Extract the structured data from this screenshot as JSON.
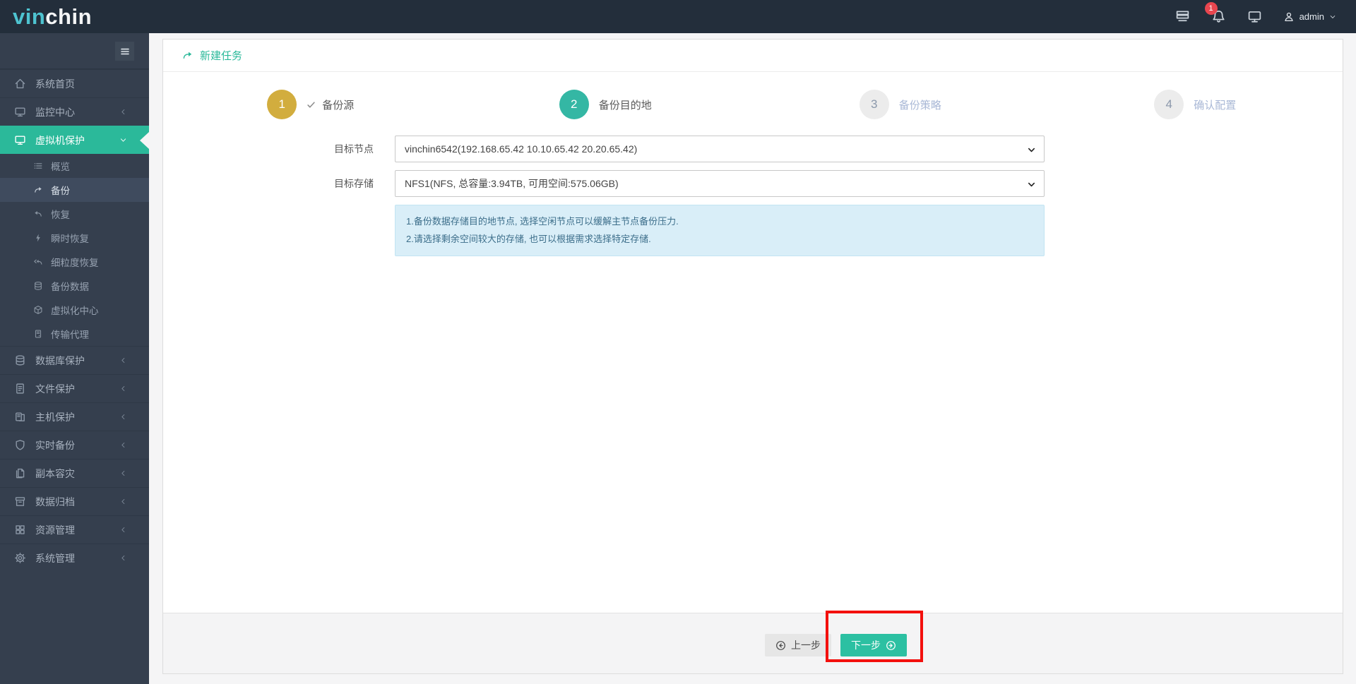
{
  "colors": {
    "accent_teal": "#2bb99a",
    "button_teal": "#2cc0a2",
    "step_done_gold": "#d2ad3e",
    "step_active_teal": "#34b7a4",
    "notification_red": "#e8464f",
    "annotation_red": "#f3100d",
    "info_box_bg": "#d9eef8",
    "header_bg": "#232e3b",
    "sidebar_bg": "#353f4e"
  },
  "header": {
    "logo_part1": "vin",
    "logo_part2": "chin",
    "notification_count": "1",
    "username": "admin"
  },
  "sidebar": {
    "items": [
      {
        "label": "系统首页",
        "icon": "home-icon"
      },
      {
        "label": "监控中心",
        "icon": "monitor-icon"
      },
      {
        "label": "虚拟机保护",
        "icon": "vm-monitor-icon"
      },
      {
        "label": "数据库保护",
        "icon": "database-icon"
      },
      {
        "label": "文件保护",
        "icon": "file-icon"
      },
      {
        "label": "主机保护",
        "icon": "host-icon"
      },
      {
        "label": "实时备份",
        "icon": "shield-icon"
      },
      {
        "label": "副本容灾",
        "icon": "copy-icon"
      },
      {
        "label": "数据归档",
        "icon": "archive-icon"
      },
      {
        "label": "资源管理",
        "icon": "grid-icon"
      },
      {
        "label": "系统管理",
        "icon": "gear-icon"
      }
    ],
    "vm_submenu": [
      {
        "label": "概览",
        "icon": "list-icon"
      },
      {
        "label": "备份",
        "icon": "redo-arrow-icon"
      },
      {
        "label": "恢复",
        "icon": "undo-arrow-icon"
      },
      {
        "label": "瞬时恢复",
        "icon": "bolt-icon"
      },
      {
        "label": "细粒度恢复",
        "icon": "undo-double-icon"
      },
      {
        "label": "备份数据",
        "icon": "database-icon"
      },
      {
        "label": "虚拟化中心",
        "icon": "cube-icon"
      },
      {
        "label": "传输代理",
        "icon": "server-icon"
      }
    ]
  },
  "page": {
    "title": "新建任务"
  },
  "wizard": {
    "steps": [
      {
        "num": "1",
        "label": "备份源",
        "state": "done"
      },
      {
        "num": "2",
        "label": "备份目的地",
        "state": "active"
      },
      {
        "num": "3",
        "label": "备份策略",
        "state": "pending"
      },
      {
        "num": "4",
        "label": "确认配置",
        "state": "pending"
      }
    ]
  },
  "form": {
    "rows": [
      {
        "label": "目标节点",
        "value": "vinchin6542(192.168.65.42 10.10.65.42 20.20.65.42)"
      },
      {
        "label": "目标存储",
        "value": "NFS1(NFS, 总容量:3.94TB, 可用空间:575.06GB)"
      }
    ],
    "info_lines": [
      "1.备份数据存储目的地节点, 选择空闲节点可以缓解主节点备份压力.",
      "2.请选择剩余空间较大的存储, 也可以根据需求选择特定存储."
    ]
  },
  "footer": {
    "prev_label": "上一步",
    "next_label": "下一步"
  }
}
